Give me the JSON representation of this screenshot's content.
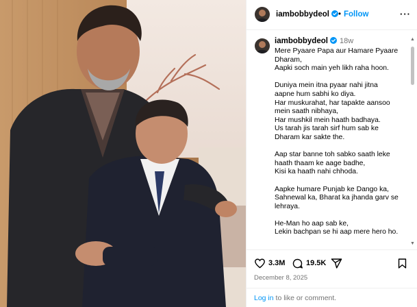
{
  "header": {
    "username": "iambobbydeol",
    "separator": "•",
    "follow_label": "Follow",
    "more_icon": "more-horizontal-icon",
    "more_label": "···"
  },
  "caption": {
    "username": "iambobbydeol",
    "age": "18w",
    "paragraphs": [
      [
        "Mere Pyaare Papa aur Hamare Pyaare",
        "Dharam,",
        "Aapki soch main yeh likh raha hoon."
      ],
      [
        "Duniya mein itna pyaar nahi jitna",
        "aapne hum sabhi ko diya.",
        "Har muskurahat, har tapakte aansoo",
        "mein saath nibhaya,",
        "Har mushkil mein haath badhaya.",
        "Us tarah jis tarah sirf hum sab ke",
        "Dharam kar sakte the."
      ],
      [
        "Aap star banne toh sabko saath leke",
        "haath thaam ke aage badhe,",
        "Kisi ka haath nahi chhoda."
      ],
      [
        "Aapke humare Punjab ke Dango ka,",
        "Sahnewal ka, Bharat ka jhanda garv se",
        "lehraya."
      ],
      [
        "He-Man ho aap sab ke,",
        "Lekin bachpan se hi aap mere hero ho."
      ]
    ]
  },
  "scrollbar": {
    "up": "▲",
    "down": "▼"
  },
  "actions": {
    "likes": "3.3M",
    "comments": "19.5K",
    "icons": {
      "like": "heart-icon",
      "comment": "comment-icon",
      "share": "share-icon",
      "save": "bookmark-icon"
    }
  },
  "date": "December 8, 2025",
  "login": {
    "link": "Log in",
    "rest": " to like or comment."
  },
  "colors": {
    "accent": "#0095f6",
    "verified": "#0095f6",
    "muted": "#737373",
    "border": "#efefef"
  }
}
